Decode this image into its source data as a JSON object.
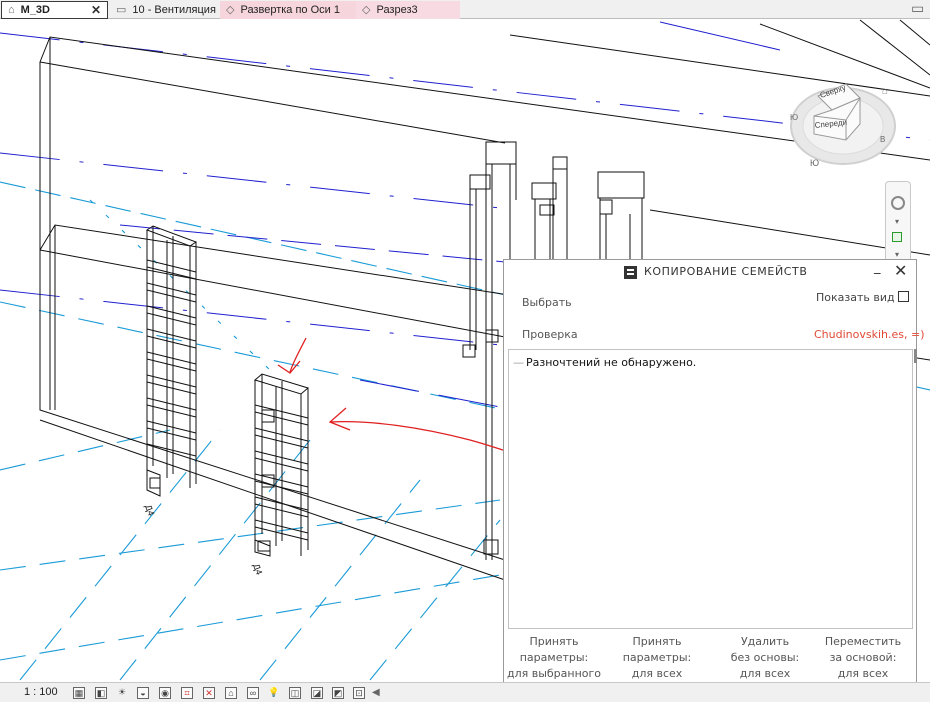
{
  "tabs": [
    {
      "label": "M_3D",
      "icon": "house-icon",
      "active": true
    },
    {
      "label": "10 - Вентиляция",
      "icon": "floor-plan-icon"
    },
    {
      "label": "Развертка по Оси 1",
      "icon": "elevation-icon"
    },
    {
      "label": "Разрез3",
      "icon": "section-icon"
    }
  ],
  "viewcube": {
    "top_label": "Сверху",
    "front_label": "Спереди"
  },
  "grid_tags": [
    "Д4",
    "Д4"
  ],
  "dialog": {
    "title": "КОПИРОВАНИЕ СЕМЕЙСТВ",
    "select_label": "Выбрать",
    "show_view_label": "Показать вид",
    "check_label": "Проверка",
    "user": "Chudinovskih.es, =)",
    "log_message": "Разночтений не обнаружено.",
    "buttons": [
      {
        "line1": "Принять",
        "line2": "параметры:",
        "line3": "для выбранного"
      },
      {
        "line1": "Принять",
        "line2": "параметры:",
        "line3": "для всех"
      },
      {
        "line1": "Удалить",
        "line2": "без основы:",
        "line3": "для всех"
      },
      {
        "line1": "Переместить",
        "line2": "за основой:",
        "line3": "для всех"
      }
    ]
  },
  "statusbar": {
    "scale": "1 : 100"
  },
  "colors": {
    "annotation": "#e02020",
    "grid": "#1a9bd7",
    "level": "#2020d0"
  }
}
